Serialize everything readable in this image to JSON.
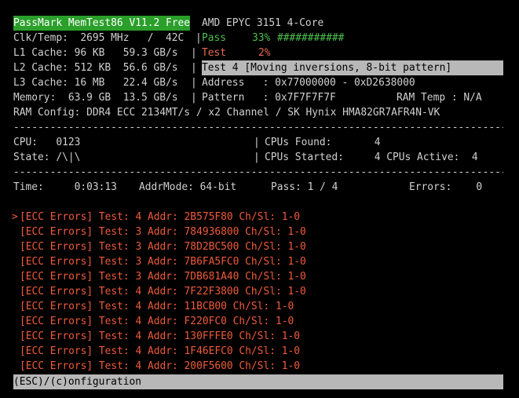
{
  "header": {
    "brand": "PassMark MemTest86 V11.2 Free",
    "cpu_name": "AMD EPYC 3151 4-Core",
    "clk_temp": "Clk/Temp:  2695 MHz   /  42C",
    "l1": "L1 Cache: 96 KB   59.3 GB/s",
    "l2": "L2 Cache: 512 KB  56.6 GB/s",
    "l3": "L3 Cache: 16 MB   22.4 GB/s",
    "memory": "Memory:  63.9 GB  13.5 GB/s",
    "ram_config": "RAM Config: DDR4 ECC 2134MT/s / x2 Channel / SK Hynix HMA82GR7AFR4N-VK",
    "pass_label": "Pass",
    "pass_percent": "33%",
    "pass_bar": "###########",
    "test_label": "Test",
    "test_percent": "2%",
    "current_test": "Test 4 [Moving inversions, 8-bit pattern]",
    "address": "Address   : 0x77000000 - 0xD2638000",
    "pattern": "Pattern   : 0x7F7F7F7F",
    "ram_temp": "RAM Temp : N/A",
    "separator": "|"
  },
  "cpu": {
    "cpu_list": "CPU:   0123",
    "state": "State: /\\|\\",
    "cpus_found": "CPUs Found:       4",
    "cpus_started": "CPUs Started:     4 CPUs Active:  4"
  },
  "status": {
    "time": "Time:     0:03:13",
    "addr_mode": "AddrMode: 64-bit",
    "pass": "Pass: 1 / 4",
    "errors": "Errors:    0"
  },
  "errors": [
    "[ECC Errors] Test: 4 Addr: 2B575F80 Ch/Sl: 1-0",
    "[ECC Errors] Test: 3 Addr: 784936800 Ch/Sl: 1-0",
    "[ECC Errors] Test: 3 Addr: 78D2BC500 Ch/Sl: 1-0",
    "[ECC Errors] Test: 3 Addr: 7B6FA5FC0 Ch/Sl: 1-0",
    "[ECC Errors] Test: 3 Addr: 7DB681A40 Ch/Sl: 1-0",
    "[ECC Errors] Test: 4 Addr: 7F22F3800 Ch/Sl: 1-0",
    "[ECC Errors] Test: 4 Addr: 11BCB00 Ch/Sl: 1-0",
    "[ECC Errors] Test: 4 Addr: F220FC0 Ch/Sl: 1-0",
    "[ECC Errors] Test: 4 Addr: 130FFFE0 Ch/Sl: 1-0",
    "[ECC Errors] Test: 4 Addr: 1F46EFC0 Ch/Sl: 1-0",
    "[ECC Errors] Test: 4 Addr: 200F5600 Ch/Sl: 1-0"
  ],
  "selection_arrow": ">",
  "footer": "(ESC)/(c)onfiguration",
  "divider": "------------------------------------------------------------------------------------------------",
  "colors": {
    "brand_bg": "#2a9f2a",
    "pass": "#4fbf4f",
    "test": "#e86a4f",
    "highlight_bg": "#b8b8b8",
    "error": "#f05a3a"
  }
}
